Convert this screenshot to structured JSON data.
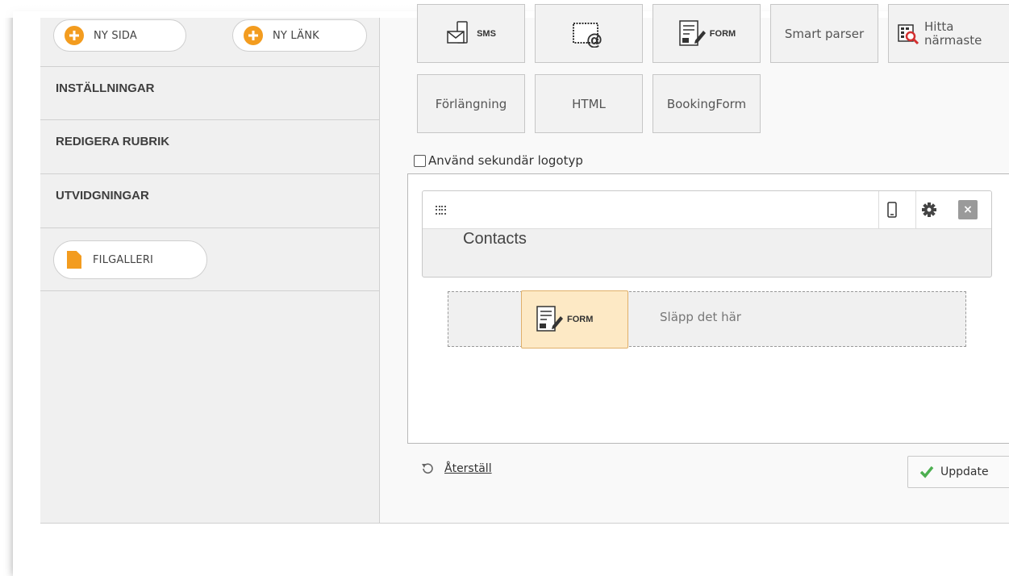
{
  "sidebar": {
    "new_page_label": "NY SIDA",
    "new_link_label": "NY LÄNK",
    "sections": [
      "INSTÄLLNINGAR",
      "REDIGERA RUBRIK",
      "UTVIDGNINGAR"
    ],
    "file_gallery_label": "FILGALLERI"
  },
  "tools": {
    "sms_label": "SMS",
    "form_label": "FORM",
    "smart_parser_label": "Smart parser",
    "find_nearest_line1": "Hitta",
    "find_nearest_line2": "närmaste",
    "extension_label": "Förlängning",
    "html_label": "HTML",
    "booking_form_label": "BookingForm"
  },
  "secondary_logo_label": "Använd sekundär logotyp",
  "widget": {
    "title": "Contacts"
  },
  "drop_zone": {
    "label": "Släpp det här",
    "drag_item_label": "FORM"
  },
  "footer": {
    "reset_label": "Återställ",
    "update_label": "Uppdate"
  },
  "colors": {
    "accent": "#f39c1f",
    "drag_bg": "#fde9c5",
    "check_green": "#4caf50"
  }
}
